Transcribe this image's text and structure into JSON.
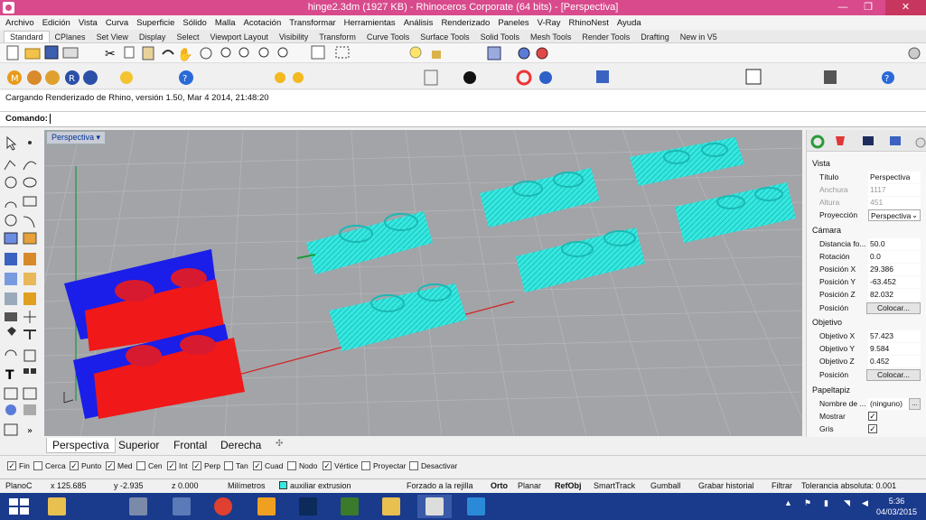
{
  "window": {
    "title": "hinge2.3dm (1927 KB) - Rhinoceros Corporate (64 bits) - [Perspectiva]",
    "minimize": "—",
    "maximize": "❐",
    "close": "✕"
  },
  "menu": [
    "Archivo",
    "Edición",
    "Vista",
    "Curva",
    "Superficie",
    "Sólido",
    "Malla",
    "Acotación",
    "Transformar",
    "Herramientas",
    "Análisis",
    "Renderizado",
    "Paneles",
    "V-Ray",
    "RhinoNest",
    "Ayuda"
  ],
  "toolbar_tabs": [
    "Standard",
    "CPlanes",
    "Set View",
    "Display",
    "Select",
    "Viewport Layout",
    "Visibility",
    "Transform",
    "Curve Tools",
    "Surface Tools",
    "Solid Tools",
    "Mesh Tools",
    "Render Tools",
    "Drafting",
    "New in V5"
  ],
  "command": {
    "history": "Cargando Renderizado de Rhino, versión 1.50, Mar  4 2014, 21:48:20",
    "prompt": "Comando:"
  },
  "viewport": {
    "label": "Perspectiva",
    "tabs": [
      "Perspectiva",
      "Superior",
      "Frontal",
      "Derecha"
    ],
    "add_tab": "✣"
  },
  "properties": {
    "vista": {
      "heading": "Vista",
      "titulo_label": "Título",
      "titulo": "Perspectiva",
      "anchura_label": "Anchura",
      "anchura": "1117",
      "altura_label": "Altura",
      "altura": "451",
      "proyeccion_label": "Proyección",
      "proyeccion": "Perspectiva"
    },
    "camara": {
      "heading": "Cámara",
      "distancia_label": "Distancia fo...",
      "distancia": "50.0",
      "rotacion_label": "Rotación",
      "rotacion": "0.0",
      "posx_label": "Posición X",
      "posx": "29.386",
      "posy_label": "Posición Y",
      "posy": "-63.452",
      "posz_label": "Posición Z",
      "posz": "82.032",
      "pos_label": "Posición",
      "colocar": "Colocar..."
    },
    "objetivo": {
      "heading": "Objetivo",
      "objx_label": "Objetivo X",
      "objx": "57.423",
      "objy_label": "Objetivo Y",
      "objy": "9.584",
      "objz_label": "Objetivo Z",
      "objz": "0.452",
      "pos_label": "Posición",
      "colocar": "Colocar..."
    },
    "papel": {
      "heading": "Papeltapiz",
      "nombre_label": "Nombre de ...",
      "nombre": "(ninguno)",
      "browse": "...",
      "mostrar_label": "Mostrar",
      "gris_label": "Gris"
    }
  },
  "osnaps": [
    {
      "label": "Fin",
      "checked": true
    },
    {
      "label": "Cerca",
      "checked": false
    },
    {
      "label": "Punto",
      "checked": true
    },
    {
      "label": "Med",
      "checked": true
    },
    {
      "label": "Cen",
      "checked": false
    },
    {
      "label": "Int",
      "checked": true
    },
    {
      "label": "Perp",
      "checked": true
    },
    {
      "label": "Tan",
      "checked": false
    },
    {
      "label": "Cuad",
      "checked": true
    },
    {
      "label": "Nodo",
      "checked": false
    },
    {
      "label": "Vértice",
      "checked": true
    },
    {
      "label": "Proyectar",
      "checked": false
    },
    {
      "label": "Desactivar",
      "checked": false
    }
  ],
  "status": {
    "cplane": "PlanoC",
    "x": "x 125.685",
    "y": "y -2.935",
    "z": "z 0.000",
    "units": "Milímetros",
    "layer": "auxiliar extrusion",
    "grid_snap": "Forzado a la rejilla",
    "orto": "Orto",
    "planar": "Planar",
    "refobj": "RefObj",
    "smarttrack": "SmartTrack",
    "gumball": "Gumball",
    "history": "Grabar historial",
    "filter": "Filtrar",
    "tolerance": "Tolerancia absoluta: 0.001"
  },
  "taskbar": {
    "time": "5:36",
    "date": "04/03/2015"
  },
  "colors": {
    "title_bar": "#d84a8c",
    "viewport_bg": "#a2a4a8",
    "cyan_objects": "#35e8e0",
    "blue_objects": "#1a1ee8",
    "red_objects": "#f01818",
    "taskbar": "#1a3a8c"
  }
}
